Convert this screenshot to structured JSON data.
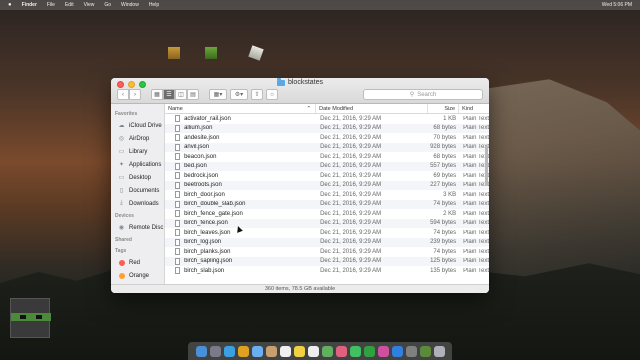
{
  "menubar": {
    "app": "Finder",
    "items": [
      "File",
      "Edit",
      "View",
      "Go",
      "Window",
      "Help"
    ],
    "clock": "Wed 5:06 PM"
  },
  "window": {
    "title": "blockstates",
    "search_placeholder": "Search",
    "columns": {
      "name": "Name",
      "date": "Date Modified",
      "size": "Size",
      "kind": "Kind"
    },
    "status": "360 items, 78.5 GB available"
  },
  "sidebar": {
    "favorites_label": "Favorites",
    "favorites": [
      "iCloud Drive",
      "AirDrop",
      "Library",
      "Applications",
      "Desktop",
      "Documents",
      "Downloads"
    ],
    "devices_label": "Devices",
    "devices": [
      "Remote Disc"
    ],
    "shared_label": "Shared",
    "tags_label": "Tags",
    "tags": [
      {
        "label": "Red",
        "color": "#ff5b52"
      },
      {
        "label": "Orange",
        "color": "#ff9f2f"
      }
    ]
  },
  "files": [
    {
      "name": "activator_rail.json",
      "date": "Dec 21, 2016, 9:29 AM",
      "size": "1 KB",
      "kind": "Plain Text"
    },
    {
      "name": "allium.json",
      "date": "Dec 21, 2016, 9:29 AM",
      "size": "68 bytes",
      "kind": "Plain Text"
    },
    {
      "name": "andesite.json",
      "date": "Dec 21, 2016, 9:29 AM",
      "size": "70 bytes",
      "kind": "Plain Text"
    },
    {
      "name": "anvil.json",
      "date": "Dec 21, 2016, 9:29 AM",
      "size": "928 bytes",
      "kind": "Plain Text"
    },
    {
      "name": "beacon.json",
      "date": "Dec 21, 2016, 9:29 AM",
      "size": "68 bytes",
      "kind": "Plain Text"
    },
    {
      "name": "bed.json",
      "date": "Dec 21, 2016, 9:29 AM",
      "size": "557 bytes",
      "kind": "Plain Text"
    },
    {
      "name": "bedrock.json",
      "date": "Dec 21, 2016, 9:29 AM",
      "size": "69 bytes",
      "kind": "Plain Text"
    },
    {
      "name": "beetroots.json",
      "date": "Dec 21, 2016, 9:29 AM",
      "size": "227 bytes",
      "kind": "Plain Text"
    },
    {
      "name": "birch_door.json",
      "date": "Dec 21, 2016, 9:29 AM",
      "size": "3 KB",
      "kind": "Plain Text"
    },
    {
      "name": "birch_double_slab.json",
      "date": "Dec 21, 2016, 9:29 AM",
      "size": "74 bytes",
      "kind": "Plain Text"
    },
    {
      "name": "birch_fence_gate.json",
      "date": "Dec 21, 2016, 9:29 AM",
      "size": "2 KB",
      "kind": "Plain Text"
    },
    {
      "name": "birch_fence.json",
      "date": "Dec 21, 2016, 9:29 AM",
      "size": "594 bytes",
      "kind": "Plain Text"
    },
    {
      "name": "birch_leaves.json",
      "date": "Dec 21, 2016, 9:29 AM",
      "size": "74 bytes",
      "kind": "Plain Text"
    },
    {
      "name": "birch_log.json",
      "date": "Dec 21, 2016, 9:29 AM",
      "size": "239 bytes",
      "kind": "Plain Text"
    },
    {
      "name": "birch_planks.json",
      "date": "Dec 21, 2016, 9:29 AM",
      "size": "74 bytes",
      "kind": "Plain Text"
    },
    {
      "name": "birch_sapling.json",
      "date": "Dec 21, 2016, 9:29 AM",
      "size": "125 bytes",
      "kind": "Plain Text"
    },
    {
      "name": "birch_slab.json",
      "date": "Dec 21, 2016, 9:29 AM",
      "size": "135 bytes",
      "kind": "Plain Text"
    },
    {
      "name": "birch_stairs.json",
      "date": "Dec 21, 2016, 9:29 AM",
      "size": "15 KB",
      "kind": "Plain Text"
    }
  ]
}
